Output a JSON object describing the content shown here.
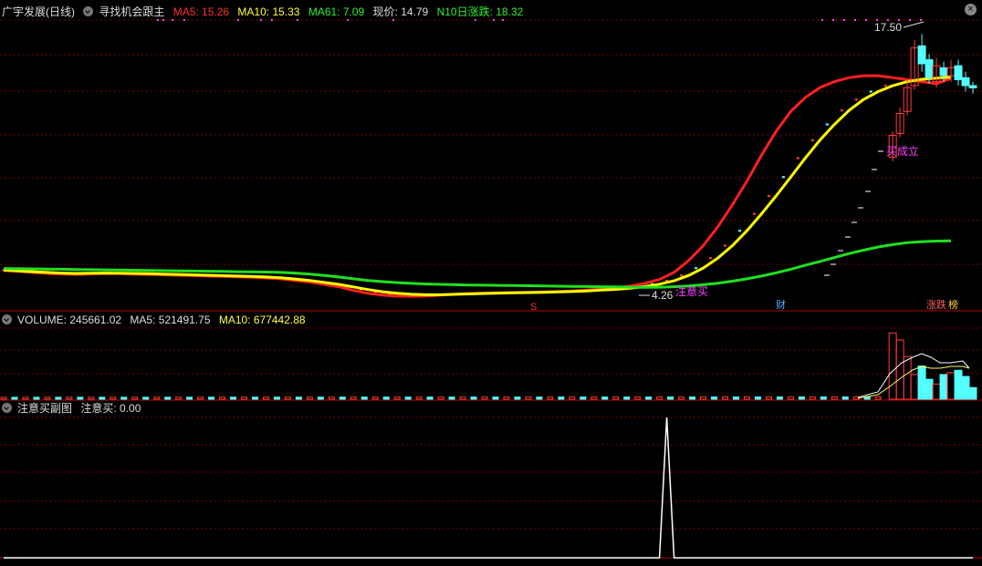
{
  "header": {
    "title": "广宇发展(日线)",
    "indicator": "寻找机会跟主",
    "ma5": "MA5: 15.26",
    "ma10": "MA10: 15.33",
    "ma61": "MA61: 7.09",
    "price": "现价: 14.79",
    "n10": "N10日涨跌: 18.32",
    "close_icon": "close-icon"
  },
  "volume_header": {
    "volume": "VOLUME: 245661.02",
    "ma5": "MA5: 521491.75",
    "ma10": "MA10: 677442.88"
  },
  "sub_header": {
    "name": "注意买副图",
    "value": "注意买: 0.00"
  },
  "annotations": {
    "high_label": "17.50",
    "low_label": "4.26",
    "buy_watch": "注意买",
    "buy_confirm": "买成立",
    "marker_s": "S",
    "marker_cai": "财",
    "marker_zhangdie": "涨跌",
    "marker_bang": "榜"
  },
  "colors": {
    "ma5": "#ff2020",
    "ma10": "#ffff00",
    "ma61": "#20e020",
    "up": "#ff3c3c",
    "down": "#54ffff",
    "grid": "#7a0000",
    "magenta": "#ff40ff",
    "text": "#e0e0e0"
  },
  "chart_data": [
    {
      "type": "line",
      "panel": "price",
      "ylim": [
        3.8,
        18.2
      ],
      "x": [
        0,
        4,
        8,
        12,
        16,
        20,
        24,
        28,
        32,
        36,
        40,
        44,
        48,
        52,
        56,
        60,
        64,
        68,
        72,
        76,
        80,
        84,
        88,
        92,
        96,
        100,
        104,
        108,
        112,
        116,
        120,
        124,
        128,
        132,
        136,
        140,
        144,
        148,
        152,
        156,
        160,
        164,
        168,
        172,
        176,
        180,
        184,
        188,
        192,
        196,
        200,
        204,
        208,
        212,
        216,
        220,
        224,
        228,
        232,
        236,
        240,
        244,
        248,
        252,
        256,
        260
      ],
      "series": [
        {
          "name": "MA5",
          "values": [
            5.6,
            5.56,
            5.5,
            5.45,
            5.42,
            5.4,
            5.43,
            5.45,
            5.44,
            5.42,
            5.4,
            5.38,
            5.36,
            5.34,
            5.32,
            5.3,
            5.28,
            5.26,
            5.22,
            5.18,
            5.1,
            5.02,
            4.9,
            4.78,
            4.6,
            4.45,
            4.36,
            4.31,
            4.3,
            4.31,
            4.36,
            4.4,
            4.44,
            4.46,
            4.48,
            4.49,
            4.5,
            4.52,
            4.54,
            4.57,
            4.61,
            4.66,
            4.72,
            4.82,
            4.95,
            5.15,
            5.5,
            6.1,
            6.85,
            7.8,
            8.9,
            10.1,
            11.4,
            12.6,
            13.6,
            14.3,
            14.8,
            15.1,
            15.3,
            15.4,
            15.4,
            15.3,
            15.2,
            15.1,
            15.0,
            15.26
          ]
        },
        {
          "name": "MA10",
          "values": [
            5.62,
            5.58,
            5.54,
            5.5,
            5.47,
            5.45,
            5.46,
            5.47,
            5.46,
            5.45,
            5.44,
            5.42,
            5.4,
            5.38,
            5.36,
            5.34,
            5.32,
            5.3,
            5.27,
            5.23,
            5.17,
            5.1,
            5.0,
            4.9,
            4.77,
            4.64,
            4.53,
            4.45,
            4.4,
            4.38,
            4.38,
            4.4,
            4.42,
            4.44,
            4.46,
            4.48,
            4.49,
            4.5,
            4.52,
            4.54,
            4.57,
            4.61,
            4.65,
            4.71,
            4.79,
            4.91,
            5.08,
            5.35,
            5.72,
            6.22,
            6.85,
            7.6,
            8.45,
            9.35,
            10.3,
            11.25,
            12.15,
            12.95,
            13.65,
            14.2,
            14.6,
            14.9,
            15.1,
            15.22,
            15.28,
            15.33
          ]
        },
        {
          "name": "MA61",
          "values": [
            5.7,
            5.69,
            5.68,
            5.67,
            5.66,
            5.65,
            5.64,
            5.63,
            5.62,
            5.61,
            5.6,
            5.59,
            5.58,
            5.57,
            5.56,
            5.55,
            5.54,
            5.53,
            5.52,
            5.5,
            5.47,
            5.42,
            5.35,
            5.27,
            5.18,
            5.1,
            5.04,
            4.99,
            4.95,
            4.92,
            4.9,
            4.88,
            4.87,
            4.86,
            4.85,
            4.84,
            4.83,
            4.82,
            4.81,
            4.8,
            4.79,
            4.78,
            4.77,
            4.76,
            4.75,
            4.76,
            4.78,
            4.82,
            4.88,
            4.96,
            5.06,
            5.18,
            5.32,
            5.48,
            5.66,
            5.86,
            6.05,
            6.25,
            6.45,
            6.62,
            6.78,
            6.9,
            7.0,
            7.05,
            7.08,
            7.09
          ]
        }
      ],
      "candles_recent": {
        "x": [
          244,
          246,
          248,
          250,
          252,
          254,
          256,
          258,
          260,
          262,
          264,
          266
        ],
        "open": [
          11.3,
          12.5,
          13.6,
          14.9,
          16.9,
          16.2,
          15.1,
          15.8,
          15.4,
          15.9,
          15.3,
          14.9
        ],
        "close": [
          12.4,
          13.5,
          14.8,
          16.8,
          16.0,
          15.3,
          15.9,
          15.4,
          15.8,
          15.2,
          14.9,
          14.79
        ],
        "high": [
          12.6,
          13.8,
          15.2,
          17.2,
          17.5,
          16.5,
          16.3,
          16.1,
          16.2,
          16.2,
          15.6,
          15.1
        ],
        "low": [
          11.1,
          12.3,
          13.4,
          14.7,
          15.6,
          15.0,
          14.8,
          15.1,
          15.1,
          14.9,
          14.6,
          14.5
        ]
      },
      "high": 17.5,
      "low": 4.26
    },
    {
      "type": "bar",
      "panel": "volume",
      "ylim": [
        0,
        1500000
      ],
      "x_range": [
        0,
        266
      ],
      "values_recent": [
        1400000,
        1250000,
        900000,
        520000,
        700000,
        420000,
        320000,
        520000,
        560000,
        610000,
        480000,
        245661.02
      ]
    },
    {
      "type": "line",
      "panel": "indicator",
      "ylim": [
        0,
        1
      ],
      "x": [
        0,
        180,
        182,
        184,
        266
      ],
      "values": [
        0,
        0,
        1,
        0,
        0
      ]
    }
  ]
}
